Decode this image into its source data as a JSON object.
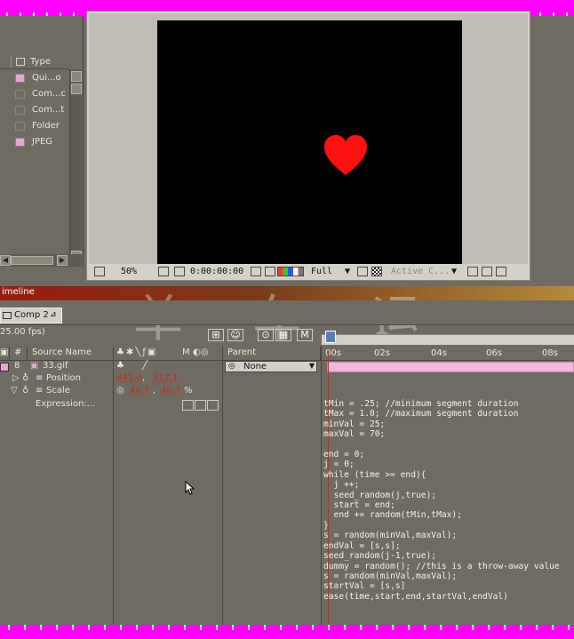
{
  "project": {
    "column_type": "Type",
    "items": [
      {
        "label": "Qui...o",
        "color": "#e7a6d0"
      },
      {
        "label": "Com...c",
        "color": "#6f6b62"
      },
      {
        "label": "Com...t",
        "color": "#6f6b62"
      },
      {
        "label": "Folder",
        "color": "#6f6b62"
      },
      {
        "label": "JPEG",
        "color": "#e7a6d0"
      }
    ]
  },
  "viewer": {
    "zoom": "50%",
    "timecode": "0:00:00:00",
    "resolution": "Full",
    "camera": "Active C..."
  },
  "timeline": {
    "title": "imeline",
    "tab_label": "Comp 2",
    "fps": "25.00 fps)",
    "columns": {
      "num": "#",
      "source": "Source Name",
      "switches": "M",
      "parent": "Parent"
    },
    "timecodes": [
      "00s",
      "02s",
      "04s",
      "06s",
      "08s"
    ],
    "layer": {
      "number": "8",
      "name": "33.gif",
      "parent": "None",
      "position_label": "Position",
      "position_x": "441.4",
      "position_y": "317.1",
      "scale_label": "Scale",
      "scale_x": "40.7",
      "scale_y": "40.7",
      "scale_unit": "%",
      "expression_label": "Expression:..."
    },
    "expression_text": "tMin = .25; //minimum segment duration\ntMax = 1.0; //maximum segment duration\nminVal = 25;\nmaxVal = 70;\n\nend = 0;\nj = 0;\nwhile (time >= end){\n  j ++;\n  seed_random(j,true);\n  start = end;\n  end += random(tMin,tMax);\n}\ns = random(minVal,maxVal);\nendVal = [s,s];\nseed_random(j-1,true);\ndummy = random(); //this is a throw-away value\ns = random(minVal,maxVal);\nstartVal = [s,s]\nease(time,start,end,startVal,endVal)"
  },
  "watermark": "单 车 运",
  "colors": {
    "accent": "#ff00ff",
    "layer_bar": "#f0b8dc",
    "title_bar": "#9a1c10"
  }
}
